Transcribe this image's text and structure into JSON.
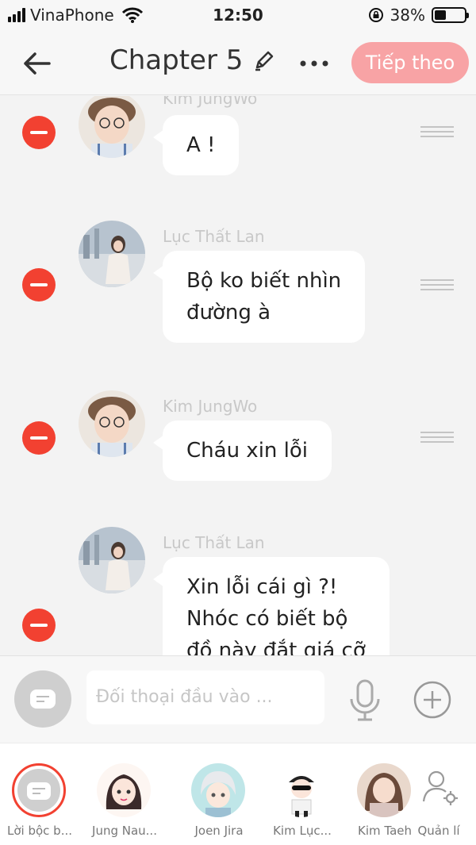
{
  "status_bar": {
    "carrier": "VinaPhone",
    "time": "12:50",
    "battery": "38%",
    "battery_level": 0.38
  },
  "header": {
    "title": "Chapter 5",
    "next_label": "Tiếp theo",
    "accent_color": "#f8a3a5"
  },
  "messages": [
    {
      "sender": "Kim JungWo",
      "lines": [
        "A !"
      ]
    },
    {
      "sender": "Lục Thất Lan",
      "lines": [
        "Bộ ko biết nhìn",
        "đường à"
      ]
    },
    {
      "sender": "Kim JungWo",
      "lines": [
        "Cháu xin lỗi"
      ]
    },
    {
      "sender": "Lục Thất Lan",
      "lines": [
        "Xin lỗi cái gì ?!",
        "Nhóc có biết bộ",
        "đồ này đắt giá cỡ"
      ]
    }
  ],
  "input": {
    "placeholder": "Đối thoại đầu vào ..."
  },
  "characters": [
    {
      "name": "Lời bộc b..."
    },
    {
      "name": "Jung Nau..."
    },
    {
      "name": "Joen Jira"
    },
    {
      "name": "Kim Lục..."
    },
    {
      "name": "Kim Taeh"
    }
  ],
  "manage_label": "Quản lí",
  "remove_color": "#f24131"
}
